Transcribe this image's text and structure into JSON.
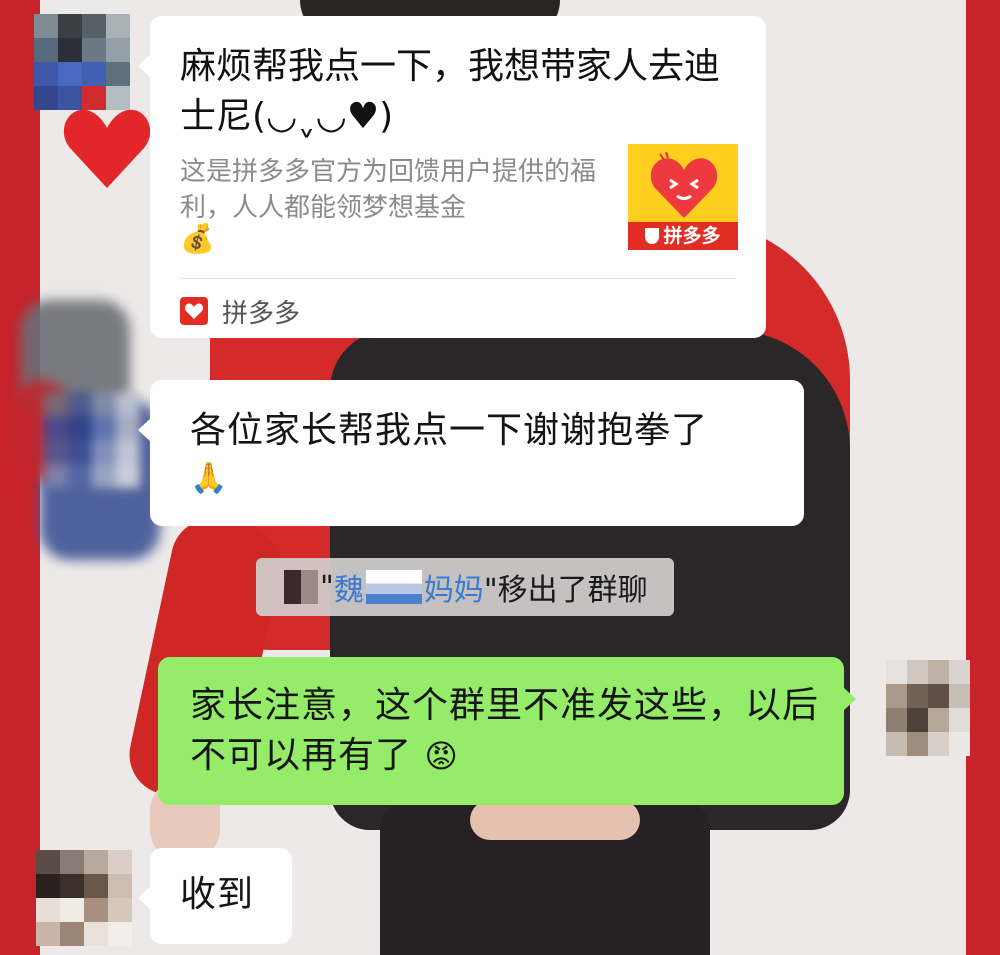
{
  "messages": {
    "card": {
      "title": "麻烦帮我点一下，我想带家人去迪士尼(◡ˬ◡♥)",
      "description": "这是拼多多官方为回馈用户提供的福利，人人都能领梦想基金",
      "emoji": "💰",
      "thumb_tag": "拼多多",
      "source": "拼多多"
    },
    "text1": {
      "text": "各位家长帮我点一下谢谢抱拳了",
      "emoji": "🙏"
    },
    "system_notice": {
      "prefix": "\"",
      "name_part1": "魏",
      "name_part2": "妈妈",
      "suffix": "\"移出了群聊"
    },
    "outgoing": {
      "text": "家长注意，这个群里不准发这些，以后不可以再有了",
      "emoji": "😡"
    },
    "reply": {
      "text": "收到"
    }
  },
  "colors": {
    "incoming_bubble": "#ffffff",
    "outgoing_bubble": "#95ec69",
    "pdd_red": "#e02e24",
    "link_blue": "#3a7ad1"
  }
}
